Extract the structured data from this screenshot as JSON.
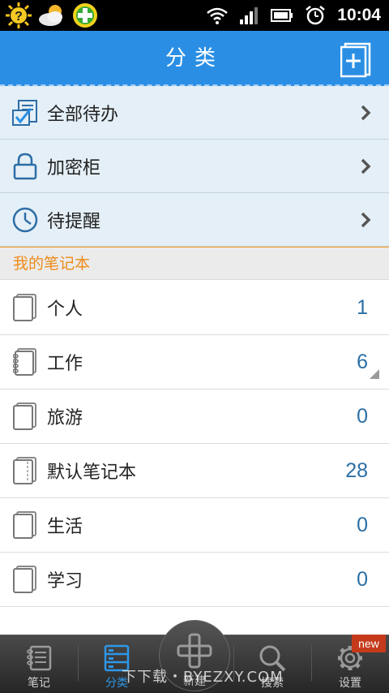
{
  "status_bar": {
    "time": "10:04",
    "left_icons": [
      "sun-question-icon",
      "cloud-sun-icon",
      "green-plus-icon"
    ],
    "right_icons": [
      "wifi-icon",
      "signal-icon",
      "battery-icon",
      "alarm-icon"
    ]
  },
  "header": {
    "title": "分类",
    "add_icon": "new-notebook-icon"
  },
  "menu": [
    {
      "label": "全部待办",
      "icon": "todo-check-icon"
    },
    {
      "label": "加密柜",
      "icon": "lock-icon"
    },
    {
      "label": "待提醒",
      "icon": "clock-icon"
    }
  ],
  "section": {
    "title": "我的笔记本"
  },
  "notebooks": [
    {
      "name": "个人",
      "count": "1"
    },
    {
      "name": "工作",
      "count": "6"
    },
    {
      "name": "旅游",
      "count": "0"
    },
    {
      "name": "默认笔记本",
      "count": "28"
    },
    {
      "name": "生活",
      "count": "0"
    },
    {
      "name": "学习",
      "count": "0"
    }
  ],
  "tabs": [
    {
      "label": "笔记",
      "icon": "notes-icon"
    },
    {
      "label": "分类",
      "icon": "category-icon"
    },
    {
      "label": "新建",
      "icon": "plus-icon"
    },
    {
      "label": "搜索",
      "icon": "search-icon"
    },
    {
      "label": "设置",
      "icon": "gear-icon"
    }
  ],
  "badge": {
    "text": "new"
  },
  "watermark": {
    "text": "下下载・BYEZXY.COM"
  },
  "colors": {
    "accent": "#2a8fe4",
    "orange": "#f39a1c",
    "count_blue": "#2a6fa5"
  }
}
